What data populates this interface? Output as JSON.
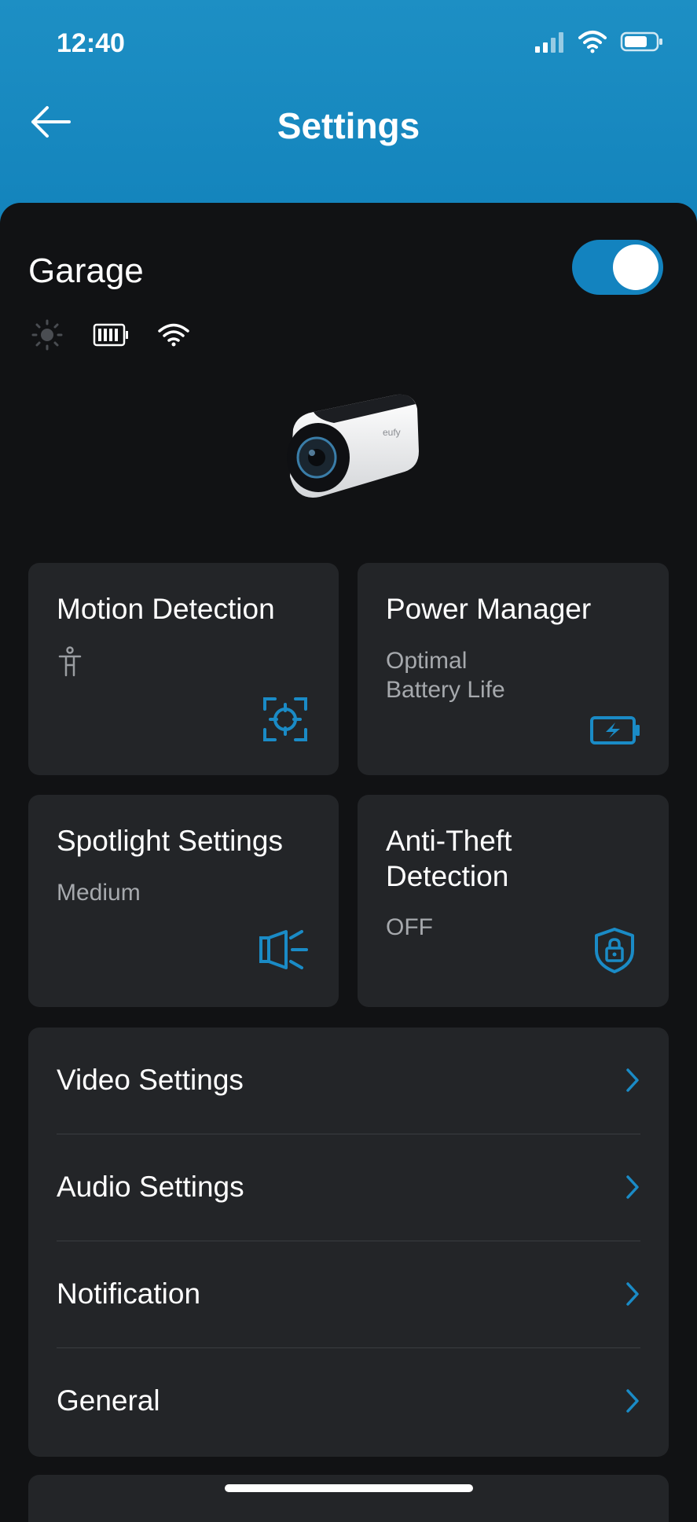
{
  "status_bar": {
    "time": "12:40"
  },
  "header": {
    "title": "Settings"
  },
  "device": {
    "name": "Garage",
    "enabled": true
  },
  "tiles": [
    {
      "title": "Motion Detection",
      "subtitle": "",
      "icon": "motion-detect-icon"
    },
    {
      "title": "Power Manager",
      "subtitle": "Optimal\nBattery Life",
      "icon": "battery-charging-icon"
    },
    {
      "title": "Spotlight Settings",
      "subtitle": "Medium",
      "icon": "spotlight-icon"
    },
    {
      "title": "Anti-Theft\nDetection",
      "subtitle": "OFF",
      "icon": "shield-lock-icon"
    }
  ],
  "menu": [
    {
      "label": "Video Settings"
    },
    {
      "label": "Audio Settings"
    },
    {
      "label": "Notification"
    },
    {
      "label": "General"
    }
  ],
  "colors": {
    "header": "#1d8fc4",
    "accent": "#1383bf",
    "card": "#232528",
    "background": "#111214"
  }
}
